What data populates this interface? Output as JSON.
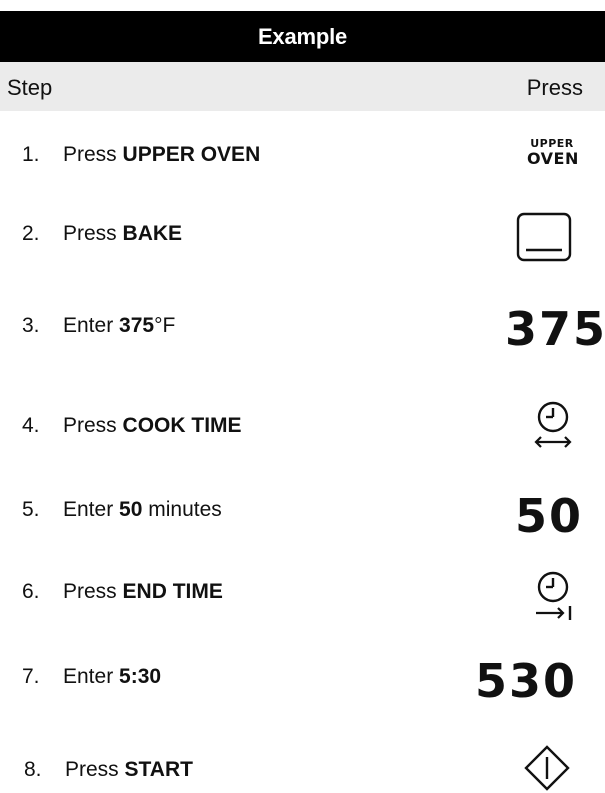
{
  "header": {
    "title": "Example"
  },
  "columns": {
    "step": "Step",
    "press": "Press"
  },
  "steps": [
    {
      "num": "1.",
      "prefix": "Press",
      "strong": "UPPER OVEN",
      "suffix": "",
      "press_kind": "label",
      "press_top": "UPPER",
      "press_bottom": "OVEN"
    },
    {
      "num": "2.",
      "prefix": "Press",
      "strong": "BAKE",
      "suffix": "",
      "press_kind": "icon",
      "icon": "bake-icon"
    },
    {
      "num": "3.",
      "prefix": "Enter",
      "strong": "375",
      "suffix": "°F",
      "press_kind": "digits",
      "press_value": "375"
    },
    {
      "num": "4.",
      "prefix": "Press",
      "strong": "COOK TIME",
      "suffix": "",
      "press_kind": "icon",
      "icon": "cook-time-icon"
    },
    {
      "num": "5.",
      "prefix": "Enter",
      "strong": "50",
      "suffix": "minutes",
      "press_kind": "digits",
      "press_value": "50"
    },
    {
      "num": "6.",
      "prefix": "Press",
      "strong": "END TIME",
      "suffix": "",
      "press_kind": "icon",
      "icon": "end-time-icon"
    },
    {
      "num": "7.",
      "prefix": "Enter",
      "strong": "5:30",
      "suffix": "",
      "press_kind": "digits",
      "press_value": "530"
    },
    {
      "num": "8.",
      "prefix": "Press",
      "strong": "START",
      "suffix": "",
      "press_kind": "icon",
      "icon": "start-icon"
    }
  ]
}
